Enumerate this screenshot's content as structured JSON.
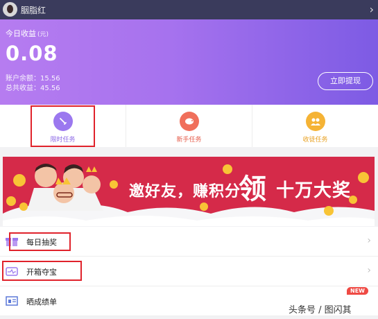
{
  "header": {
    "username": "胭脂红",
    "chevron": "›"
  },
  "earnings": {
    "today_label": "今日收益",
    "today_unit": "(元)",
    "today_value": "0.08",
    "balance_text": "账户余额：15.56",
    "total_text": "总共收益：45.56",
    "withdraw_label": "立即提现"
  },
  "tasks": [
    {
      "label": "限时任务",
      "icon": "pen-icon",
      "color": "#9b78ef"
    },
    {
      "label": "新手任务",
      "icon": "pig-icon",
      "color": "#f06f5b"
    },
    {
      "label": "收徒任务",
      "icon": "people-icon",
      "color": "#f5b335"
    }
  ],
  "banner": {
    "text_a": "邀好友，赚积分",
    "text_b": "领",
    "text_c": "十万大奖",
    "colors": {
      "bg": "#d52a49",
      "gold": "#f8c436"
    }
  },
  "menu": [
    {
      "label": "每日抽奖",
      "icon": "gift-icon"
    },
    {
      "label": "开箱夺宝",
      "icon": "chest-icon"
    },
    {
      "label": "晒成绩单",
      "icon": "report-icon",
      "badge": "NEW"
    }
  ],
  "watermark": "头条号 / 图闪其",
  "colors": {
    "header": "#3a3b5c",
    "highlight": "#e0222b",
    "purple_start": "#b67cf0",
    "purple_end": "#7d5be4"
  }
}
